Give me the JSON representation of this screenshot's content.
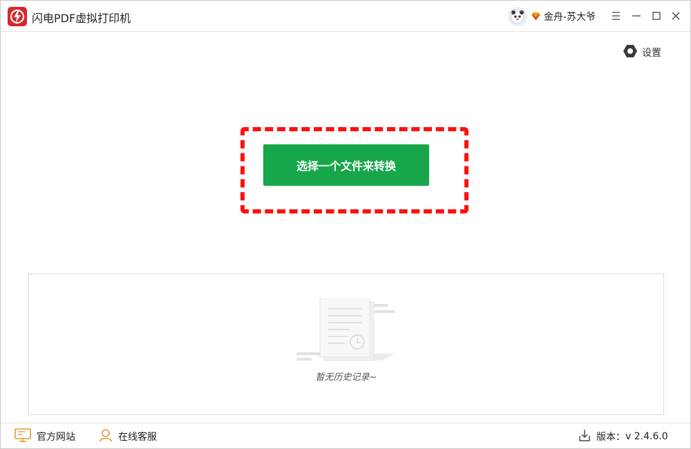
{
  "titlebar": {
    "app_title": "闪电PDF虚拟打印机",
    "user_name": "金舟-苏大爷",
    "icons": [
      "app-logo",
      "avatar",
      "vip-icon",
      "menu-icon",
      "minimize-icon",
      "maximize-icon",
      "close-icon"
    ]
  },
  "settings": {
    "label": "设置",
    "icon": "gear-icon"
  },
  "main": {
    "convert_button_label": "选择一个文件来转换",
    "highlight_color": "#ff1010",
    "button_color": "#17a74a"
  },
  "history": {
    "empty_text": "暂无历史记录~",
    "icon": "empty-document-icon"
  },
  "footer": {
    "website_label": "官方网站",
    "support_label": "在线客服",
    "version_label": "版本：",
    "version_value": "v 2.4.6.0",
    "icons": [
      "monitor-icon",
      "user-icon",
      "download-icon"
    ]
  }
}
